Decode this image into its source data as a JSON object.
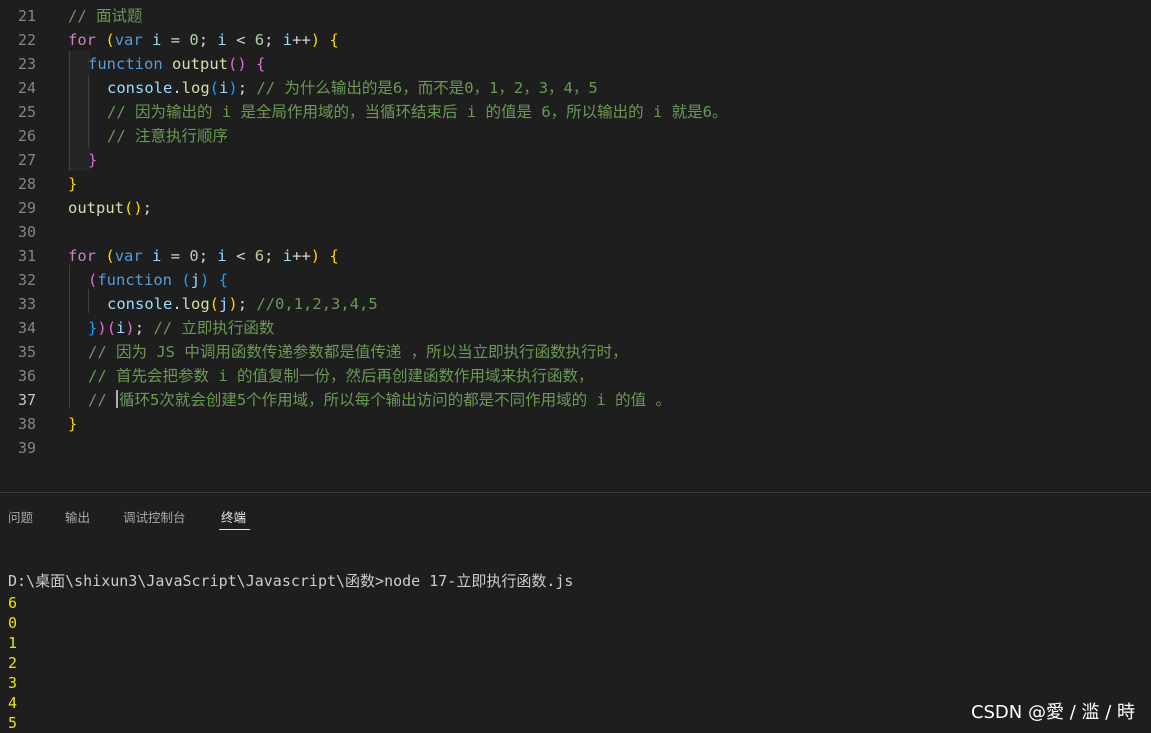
{
  "editor": {
    "active_line": "37",
    "lines": [
      {
        "no": "21",
        "tokens": [
          [
            "c",
            "// 面试题"
          ]
        ]
      },
      {
        "no": "22",
        "tokens": [
          [
            "k",
            "for"
          ],
          [
            "p",
            " "
          ],
          [
            "b1",
            "("
          ],
          [
            "kb",
            "var"
          ],
          [
            "p",
            " "
          ],
          [
            "v",
            "i"
          ],
          [
            "p",
            " = "
          ],
          [
            "n",
            "0"
          ],
          [
            "p",
            "; "
          ],
          [
            "v",
            "i"
          ],
          [
            "p",
            " < "
          ],
          [
            "n",
            "6"
          ],
          [
            "p",
            "; "
          ],
          [
            "v",
            "i"
          ],
          [
            "p",
            "++"
          ],
          [
            "b1",
            ")"
          ],
          [
            "p",
            " "
          ],
          [
            "b1",
            "{"
          ]
        ]
      },
      {
        "no": "23",
        "tokens": [
          [
            "kb",
            "function"
          ],
          [
            "p",
            " "
          ],
          [
            "f",
            "output"
          ],
          [
            "b2",
            "()"
          ],
          [
            "p",
            " "
          ],
          [
            "b2",
            "{"
          ]
        ]
      },
      {
        "no": "24",
        "tokens": [
          [
            "v",
            "console"
          ],
          [
            "p",
            "."
          ],
          [
            "f",
            "log"
          ],
          [
            "b3",
            "("
          ],
          [
            "v",
            "i"
          ],
          [
            "b3",
            ")"
          ],
          [
            "p",
            "; "
          ],
          [
            "c",
            "// 为什么输出的是6，而不是0，1，2，3，4，5"
          ]
        ]
      },
      {
        "no": "25",
        "tokens": [
          [
            "c",
            "// 因为输出的 i 是全局作用域的，当循环结束后 i 的值是 6，所以输出的 i 就是6。"
          ]
        ]
      },
      {
        "no": "26",
        "tokens": [
          [
            "c",
            "// 注意执行顺序"
          ]
        ]
      },
      {
        "no": "27",
        "tokens": [
          [
            "b2",
            "}"
          ]
        ]
      },
      {
        "no": "28",
        "tokens": [
          [
            "b1",
            "}"
          ]
        ]
      },
      {
        "no": "29",
        "tokens": [
          [
            "f",
            "output"
          ],
          [
            "b1",
            "()"
          ],
          [
            "p",
            ";"
          ]
        ]
      },
      {
        "no": "30",
        "tokens": []
      },
      {
        "no": "31",
        "tokens": [
          [
            "k",
            "for"
          ],
          [
            "p",
            " "
          ],
          [
            "b1",
            "("
          ],
          [
            "kb",
            "var"
          ],
          [
            "p",
            " "
          ],
          [
            "v",
            "i"
          ],
          [
            "p",
            " = "
          ],
          [
            "n",
            "0"
          ],
          [
            "p",
            "; "
          ],
          [
            "v",
            "i"
          ],
          [
            "p",
            " < "
          ],
          [
            "n",
            "6"
          ],
          [
            "p",
            "; "
          ],
          [
            "v",
            "i"
          ],
          [
            "p",
            "++"
          ],
          [
            "b1",
            ")"
          ],
          [
            "p",
            " "
          ],
          [
            "b1",
            "{"
          ]
        ]
      },
      {
        "no": "32",
        "tokens": [
          [
            "b2",
            "("
          ],
          [
            "kb",
            "function"
          ],
          [
            "p",
            " "
          ],
          [
            "b3",
            "("
          ],
          [
            "v",
            "j"
          ],
          [
            "b3",
            ")"
          ],
          [
            "p",
            " "
          ],
          [
            "b3",
            "{"
          ]
        ]
      },
      {
        "no": "33",
        "tokens": [
          [
            "v",
            "console"
          ],
          [
            "p",
            "."
          ],
          [
            "f",
            "log"
          ],
          [
            "b1",
            "("
          ],
          [
            "v",
            "j"
          ],
          [
            "b1",
            ")"
          ],
          [
            "p",
            "; "
          ],
          [
            "c",
            "//0,1,2,3,4,5"
          ]
        ]
      },
      {
        "no": "34",
        "tokens": [
          [
            "b3",
            "}"
          ],
          [
            "b2",
            ")"
          ],
          [
            "b2",
            "("
          ],
          [
            "v",
            "i"
          ],
          [
            "b2",
            ")"
          ],
          [
            "p",
            "; "
          ],
          [
            "c",
            "// 立即执行函数"
          ]
        ]
      },
      {
        "no": "35",
        "tokens": [
          [
            "c",
            "// 因为 JS 中调用函数传递参数都是值传递 ，所以当立即执行函数执行时，"
          ]
        ]
      },
      {
        "no": "36",
        "tokens": [
          [
            "c",
            "// 首先会把参数 i 的值复制一份，然后再创建函数作用域来执行函数，"
          ]
        ]
      },
      {
        "no": "37",
        "tokens": [
          [
            "c",
            "// "
          ],
          [
            "cursor",
            ""
          ],
          [
            "c",
            "循环5次就会创建5个作用域，所以每个输出访问的都是不同作用域的 i 的值 。"
          ]
        ]
      },
      {
        "no": "38",
        "tokens": [
          [
            "b1",
            "}"
          ]
        ]
      },
      {
        "no": "39",
        "tokens": []
      }
    ]
  },
  "panel": {
    "tabs": [
      {
        "label": "问题",
        "active": false
      },
      {
        "label": "输出",
        "active": false
      },
      {
        "label": "调试控制台",
        "active": false
      },
      {
        "label": "终端",
        "active": true
      }
    ],
    "terminal": {
      "command": "D:\\桌面\\shixun3\\JavaScript\\Javascript\\函数>node 17-立即执行函数.js",
      "output": [
        "6",
        "0",
        "1",
        "2",
        "3",
        "4",
        "5"
      ]
    }
  },
  "watermark": "CSDN @愛 / 滥 / 時",
  "colors": {
    "background": "#1e1e1e",
    "keyword_control": "#c586c0",
    "keyword": "#569cd6",
    "variable": "#9cdcfe",
    "function": "#dcdcaa",
    "number": "#b5cea8",
    "comment": "#6a9955",
    "bracket_1": "#ffd700",
    "bracket_2": "#da70d6",
    "bracket_3": "#179fff",
    "terminal_output": "#e5e510"
  }
}
